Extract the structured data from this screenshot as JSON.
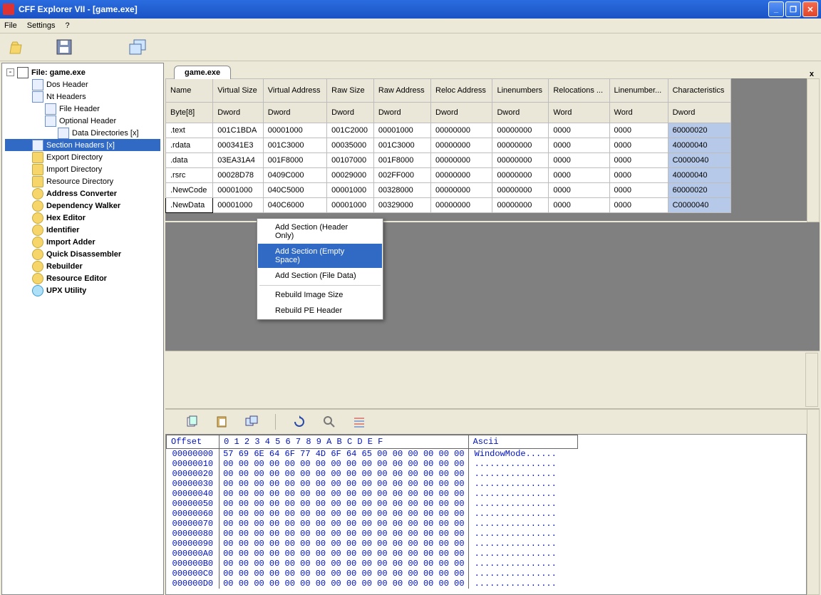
{
  "window": {
    "title": "CFF Explorer VII - [game.exe]"
  },
  "menu": {
    "file": "File",
    "settings": "Settings",
    "help": "?"
  },
  "tab": {
    "label": "game.exe",
    "close": "x"
  },
  "tree": {
    "root": "File: game.exe",
    "items": [
      {
        "label": "Dos Header",
        "indent": 2,
        "icon": "page"
      },
      {
        "label": "Nt Headers",
        "indent": 2,
        "icon": "page"
      },
      {
        "label": "File Header",
        "indent": 3,
        "icon": "page"
      },
      {
        "label": "Optional Header",
        "indent": 3,
        "icon": "page"
      },
      {
        "label": "Data Directories [x]",
        "indent": 4,
        "icon": "page"
      },
      {
        "label": "Section Headers [x]",
        "indent": 2,
        "icon": "page",
        "sel": true
      },
      {
        "label": "Export Directory",
        "indent": 2,
        "icon": "folder"
      },
      {
        "label": "Import Directory",
        "indent": 2,
        "icon": "folder"
      },
      {
        "label": "Resource Directory",
        "indent": 2,
        "icon": "folder"
      },
      {
        "label": "Address Converter",
        "indent": 2,
        "icon": "plug",
        "bold": true
      },
      {
        "label": "Dependency Walker",
        "indent": 2,
        "icon": "plug",
        "bold": true
      },
      {
        "label": "Hex Editor",
        "indent": 2,
        "icon": "plug",
        "bold": true
      },
      {
        "label": "Identifier",
        "indent": 2,
        "icon": "plug",
        "bold": true
      },
      {
        "label": "Import Adder",
        "indent": 2,
        "icon": "plug",
        "bold": true
      },
      {
        "label": "Quick Disassembler",
        "indent": 2,
        "icon": "plug",
        "bold": true
      },
      {
        "label": "Rebuilder",
        "indent": 2,
        "icon": "plug",
        "bold": true
      },
      {
        "label": "Resource Editor",
        "indent": 2,
        "icon": "plug",
        "bold": true
      },
      {
        "label": "UPX Utility",
        "indent": 2,
        "icon": "blue",
        "bold": true
      }
    ]
  },
  "sections": {
    "headers": [
      "Name",
      "Virtual Size",
      "Virtual Address",
      "Raw Size",
      "Raw Address",
      "Reloc Address",
      "Linenumbers",
      "Relocations ...",
      "Linenumber...",
      "Characteristics"
    ],
    "types": [
      "Byte[8]",
      "Dword",
      "Dword",
      "Dword",
      "Dword",
      "Dword",
      "Dword",
      "Word",
      "Word",
      "Dword"
    ],
    "rows": [
      {
        "name": ".text",
        "vs": "001C1BDA",
        "va": "00001000",
        "rs": "001C2000",
        "ra": "00001000",
        "rel": "00000000",
        "ln": "00000000",
        "nr": "0000",
        "nl": "0000",
        "ch": "60000020"
      },
      {
        "name": ".rdata",
        "vs": "000341E3",
        "va": "001C3000",
        "rs": "00035000",
        "ra": "001C3000",
        "rel": "00000000",
        "ln": "00000000",
        "nr": "0000",
        "nl": "0000",
        "ch": "40000040"
      },
      {
        "name": ".data",
        "vs": "03EA31A4",
        "va": "001F8000",
        "rs": "00107000",
        "ra": "001F8000",
        "rel": "00000000",
        "ln": "00000000",
        "nr": "0000",
        "nl": "0000",
        "ch": "C0000040"
      },
      {
        "name": ".rsrc",
        "vs": "00028D78",
        "va": "0409C000",
        "rs": "00029000",
        "ra": "002FF000",
        "rel": "00000000",
        "ln": "00000000",
        "nr": "0000",
        "nl": "0000",
        "ch": "40000040"
      },
      {
        "name": ".NewCode",
        "vs": "00001000",
        "va": "040C5000",
        "rs": "00001000",
        "ra": "00328000",
        "rel": "00000000",
        "ln": "00000000",
        "nr": "0000",
        "nl": "0000",
        "ch": "60000020"
      },
      {
        "name": ".NewData",
        "vs": "00001000",
        "va": "040C6000",
        "rs": "00001000",
        "ra": "00329000",
        "rel": "00000000",
        "ln": "00000000",
        "nr": "0000",
        "nl": "0000",
        "ch": "C0000040",
        "selname": true
      }
    ]
  },
  "context": {
    "items": [
      {
        "label": "Add Section (Header Only)"
      },
      {
        "label": "Add Section (Empty Space)",
        "hover": true
      },
      {
        "label": "Add Section (File Data)"
      },
      {
        "sep": true
      },
      {
        "label": "Rebuild Image Size"
      },
      {
        "label": "Rebuild PE Header"
      }
    ]
  },
  "hex": {
    "header_offset": "Offset",
    "header_cols": [
      "0",
      "1",
      "2",
      "3",
      "4",
      "5",
      "6",
      "7",
      "8",
      "9",
      "A",
      "B",
      "C",
      "D",
      "E",
      "F"
    ],
    "header_ascii": "Ascii",
    "rows": [
      {
        "off": "00000000",
        "b": [
          "57",
          "69",
          "6E",
          "64",
          "6F",
          "77",
          "4D",
          "6F",
          "64",
          "65",
          "00",
          "00",
          "00",
          "00",
          "00",
          "00"
        ],
        "a": "WindowMode......"
      },
      {
        "off": "00000010",
        "b": [
          "00",
          "00",
          "00",
          "00",
          "00",
          "00",
          "00",
          "00",
          "00",
          "00",
          "00",
          "00",
          "00",
          "00",
          "00",
          "00"
        ],
        "a": "................"
      },
      {
        "off": "00000020",
        "b": [
          "00",
          "00",
          "00",
          "00",
          "00",
          "00",
          "00",
          "00",
          "00",
          "00",
          "00",
          "00",
          "00",
          "00",
          "00",
          "00"
        ],
        "a": "................"
      },
      {
        "off": "00000030",
        "b": [
          "00",
          "00",
          "00",
          "00",
          "00",
          "00",
          "00",
          "00",
          "00",
          "00",
          "00",
          "00",
          "00",
          "00",
          "00",
          "00"
        ],
        "a": "................"
      },
      {
        "off": "00000040",
        "b": [
          "00",
          "00",
          "00",
          "00",
          "00",
          "00",
          "00",
          "00",
          "00",
          "00",
          "00",
          "00",
          "00",
          "00",
          "00",
          "00"
        ],
        "a": "................"
      },
      {
        "off": "00000050",
        "b": [
          "00",
          "00",
          "00",
          "00",
          "00",
          "00",
          "00",
          "00",
          "00",
          "00",
          "00",
          "00",
          "00",
          "00",
          "00",
          "00"
        ],
        "a": "................"
      },
      {
        "off": "00000060",
        "b": [
          "00",
          "00",
          "00",
          "00",
          "00",
          "00",
          "00",
          "00",
          "00",
          "00",
          "00",
          "00",
          "00",
          "00",
          "00",
          "00"
        ],
        "a": "................"
      },
      {
        "off": "00000070",
        "b": [
          "00",
          "00",
          "00",
          "00",
          "00",
          "00",
          "00",
          "00",
          "00",
          "00",
          "00",
          "00",
          "00",
          "00",
          "00",
          "00"
        ],
        "a": "................"
      },
      {
        "off": "00000080",
        "b": [
          "00",
          "00",
          "00",
          "00",
          "00",
          "00",
          "00",
          "00",
          "00",
          "00",
          "00",
          "00",
          "00",
          "00",
          "00",
          "00"
        ],
        "a": "................"
      },
      {
        "off": "00000090",
        "b": [
          "00",
          "00",
          "00",
          "00",
          "00",
          "00",
          "00",
          "00",
          "00",
          "00",
          "00",
          "00",
          "00",
          "00",
          "00",
          "00"
        ],
        "a": "................"
      },
      {
        "off": "000000A0",
        "b": [
          "00",
          "00",
          "00",
          "00",
          "00",
          "00",
          "00",
          "00",
          "00",
          "00",
          "00",
          "00",
          "00",
          "00",
          "00",
          "00"
        ],
        "a": "................"
      },
      {
        "off": "000000B0",
        "b": [
          "00",
          "00",
          "00",
          "00",
          "00",
          "00",
          "00",
          "00",
          "00",
          "00",
          "00",
          "00",
          "00",
          "00",
          "00",
          "00"
        ],
        "a": "................"
      },
      {
        "off": "000000C0",
        "b": [
          "00",
          "00",
          "00",
          "00",
          "00",
          "00",
          "00",
          "00",
          "00",
          "00",
          "00",
          "00",
          "00",
          "00",
          "00",
          "00"
        ],
        "a": "................"
      },
      {
        "off": "000000D0",
        "b": [
          "00",
          "00",
          "00",
          "00",
          "00",
          "00",
          "00",
          "00",
          "00",
          "00",
          "00",
          "00",
          "00",
          "00",
          "00",
          "00"
        ],
        "a": "................"
      }
    ]
  }
}
